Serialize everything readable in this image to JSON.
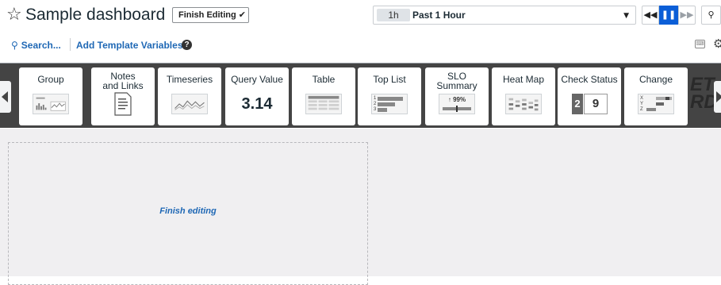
{
  "header": {
    "star_glyph": "☆",
    "title": "Sample dashboard",
    "finish_button_label": "Finish Editing",
    "finish_button_glyph": "✔"
  },
  "timepicker": {
    "badge": "1h",
    "label": "Past 1 Hour",
    "caret": "▼"
  },
  "controls": {
    "back_glyph": "◀◀",
    "pause_glyph": "❚❚",
    "forward_glyph": "▶▶",
    "search_glyph": "⚲"
  },
  "subheader": {
    "search_label": "Search...",
    "search_glyph": "⚲",
    "template_vars_label": "Add Template Variables",
    "help_glyph": "?",
    "keyboard_glyph": "⌨",
    "settings_glyph": "⚙"
  },
  "tray": {
    "widgets": [
      {
        "label": "Group",
        "icon": "group-thumbnail-icon"
      },
      {
        "label": "Notes\nand Links",
        "icon": "note-document-icon"
      },
      {
        "label": "Timeseries",
        "icon": "timeseries-line-icon"
      },
      {
        "label": "Query Value",
        "value": "3.14"
      },
      {
        "label": "Table",
        "icon": "table-grid-icon"
      },
      {
        "label": "Top List",
        "icon": "toplist-bars-icon",
        "ranks": [
          "1",
          "2",
          "3"
        ]
      },
      {
        "label": "SLO\nSummary",
        "icon": "slo-summary-icon",
        "percent": "99%"
      },
      {
        "label": "Heat Map",
        "icon": "heatmap-icon"
      },
      {
        "label": "Check Status",
        "values": [
          "2",
          "9"
        ]
      },
      {
        "label": "Change",
        "icon": "change-chart-icon",
        "letters": [
          "X",
          "Y",
          "Z"
        ]
      }
    ],
    "ghost_text": "ET\nRD"
  },
  "canvas": {
    "placeholder_link": "Finish editing"
  },
  "colors": {
    "link_blue": "#1f68b5",
    "primary_blue": "#0b5ed7",
    "tray_bg": "#444444",
    "canvas_bg": "#f0eff1"
  }
}
